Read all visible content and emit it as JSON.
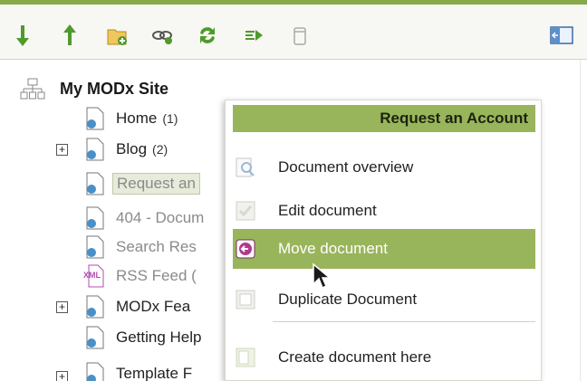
{
  "toolbar": {
    "icons": [
      "sort-down-icon",
      "sort-up-icon",
      "new-document-icon",
      "new-weblink-icon",
      "refresh-icon",
      "sort-icon",
      "purge-trash-icon",
      "toggle-panel-icon"
    ]
  },
  "tree": {
    "root_label": "My MODx Site",
    "nodes": [
      {
        "label": "Home",
        "count": "(1)"
      },
      {
        "label": "Blog",
        "count": "(2)"
      },
      {
        "label": "Request an",
        "count": ""
      },
      {
        "label": "404 - Docum",
        "count": ""
      },
      {
        "label": "Search Res",
        "count": ""
      },
      {
        "label": "RSS Feed (",
        "count": ""
      },
      {
        "label": "MODx Fea",
        "count": ""
      },
      {
        "label": "Getting Help",
        "count": ""
      },
      {
        "label": "Template F",
        "count": ""
      }
    ]
  },
  "context_menu": {
    "header": "Request an Account",
    "items": [
      {
        "label": "Document overview",
        "icon": "magnifier-icon"
      },
      {
        "label": "Edit document",
        "icon": "edit-icon"
      },
      {
        "label": "Move document",
        "icon": "move-icon"
      },
      {
        "label": "Duplicate Document",
        "icon": "duplicate-icon"
      },
      {
        "label": "Create document here",
        "icon": "create-icon"
      }
    ]
  },
  "colors": {
    "accent": "#99b55b",
    "topbar_border": "#86a94a",
    "arrow_green": "#4e9a2b"
  }
}
